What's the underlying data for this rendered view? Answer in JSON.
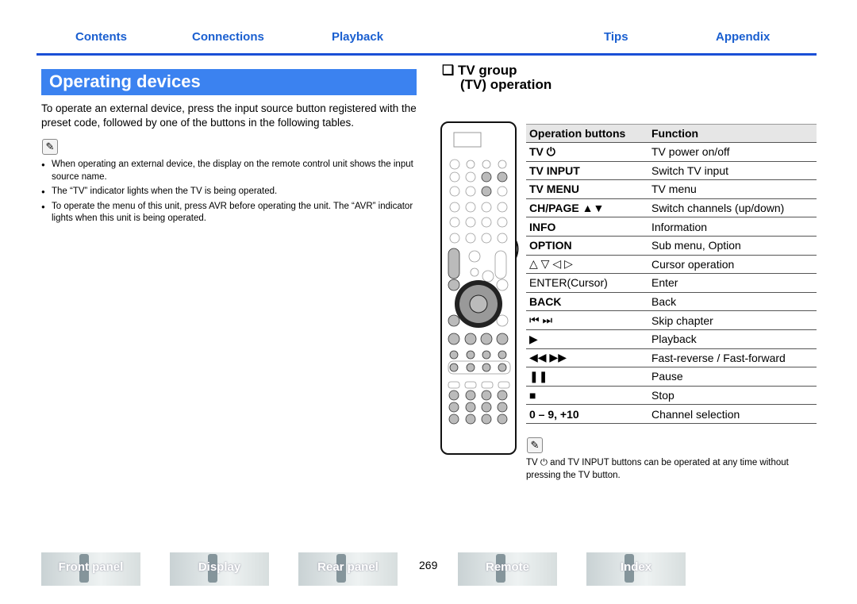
{
  "nav": [
    "Contents",
    "Connections",
    "Playback",
    "Tips",
    "Appendix"
  ],
  "title": "Operating devices",
  "intro": "To operate an external device, press the input source button registered with the preset code, followed by one of the buttons in the following tables.",
  "bullets": [
    "When operating an external device, the display on the remote control unit shows the input source name.",
    "The “TV” indicator lights when the TV is being operated.",
    "To operate the menu of this unit, press AVR before operating the unit. The “AVR” indicator lights when this unit is being operated."
  ],
  "section": {
    "line1": "❑ TV group",
    "line2": "(TV) operation"
  },
  "table": {
    "headers": [
      "Operation buttons",
      "Function"
    ],
    "rows": [
      [
        "TV ⏻",
        "TV power on/off"
      ],
      [
        "TV INPUT",
        "Switch TV input"
      ],
      [
        "TV MENU",
        "TV menu"
      ],
      [
        "CH/PAGE ▲▼",
        "Switch channels (up/down)"
      ],
      [
        "INFO",
        "Information"
      ],
      [
        "OPTION",
        "Sub menu, Option"
      ],
      [
        "△ ▽ ◁ ▷",
        "Cursor operation"
      ],
      [
        "ENTER(Cursor)",
        "Enter"
      ],
      [
        "BACK",
        "Back"
      ],
      [
        "⏮ ⏭",
        "Skip chapter"
      ],
      [
        "▶",
        "Playback"
      ],
      [
        "◀◀ ▶▶",
        "Fast-reverse / Fast-forward"
      ],
      [
        "❚❚",
        "Pause"
      ],
      [
        "■",
        "Stop"
      ],
      [
        "0 – 9, +10",
        "Channel selection"
      ]
    ]
  },
  "note": "TV ⏻ and TV INPUT buttons can be operated at any time without pressing the TV button.",
  "footer": [
    "Front panel",
    "Display",
    "Rear panel",
    "Remote",
    "Index"
  ],
  "page": "269",
  "colors": {
    "accent": "#1a4fd6",
    "title_bg": "#3b82f0"
  }
}
